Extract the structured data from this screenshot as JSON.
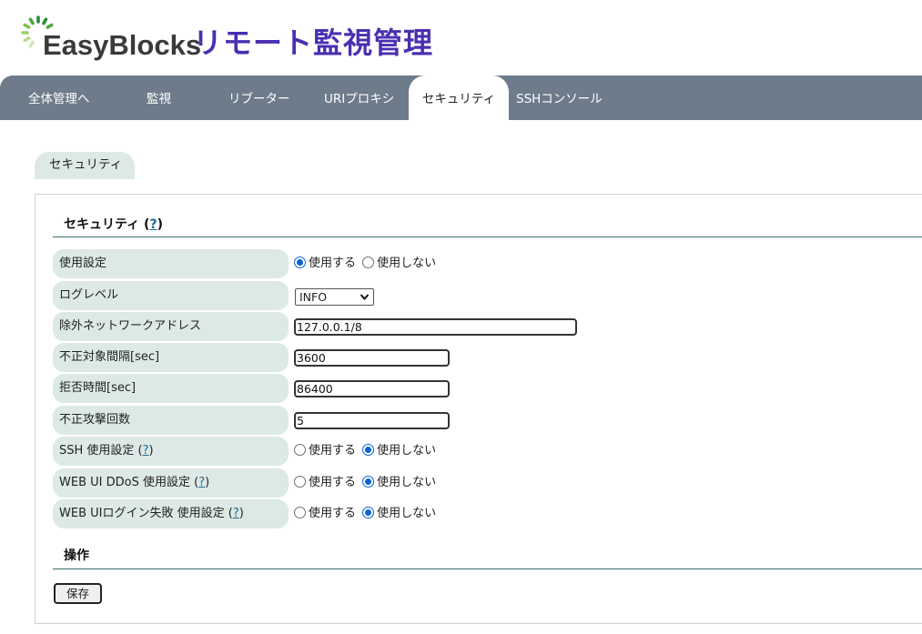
{
  "header": {
    "brand": "EasyBlocks",
    "app_title": "リモート監視管理",
    "logo_colors": [
      "#2e8b3a",
      "#7cc243",
      "#b5dc8a"
    ]
  },
  "nav": {
    "items": [
      {
        "label": "全体管理へ"
      },
      {
        "label": "監視"
      },
      {
        "label": "リブーター"
      },
      {
        "label": "URIプロキシ"
      },
      {
        "label": "セキュリティ",
        "active": true
      },
      {
        "label": "SSHコンソール"
      }
    ]
  },
  "section_tab": "セキュリティ",
  "security": {
    "heading": "セキュリティ",
    "help": "?",
    "rows": {
      "enable": {
        "label": "使用設定",
        "options": [
          "使用する",
          "使用しない"
        ],
        "selected": "使用する"
      },
      "log_level": {
        "label": "ログレベル",
        "value": "INFO"
      },
      "exclude_net": {
        "label": "除外ネットワークアドレス",
        "value": "127.0.0.1/8"
      },
      "interval": {
        "label": "不正対象間隔[sec]",
        "value": "3600"
      },
      "deny_time": {
        "label": "拒否時間[sec]",
        "value": "86400"
      },
      "attack_count": {
        "label": "不正攻撃回数",
        "value": "5"
      },
      "ssh": {
        "label": "SSH 使用設定",
        "options": [
          "使用する",
          "使用しない"
        ],
        "selected": "使用しない"
      },
      "webui_ddos": {
        "label": "WEB UI DDoS 使用設定",
        "options": [
          "使用する",
          "使用しない"
        ],
        "selected": "使用しない"
      },
      "webui_login": {
        "label": "WEB UIログイン失敗 使用設定",
        "options": [
          "使用する",
          "使用しない"
        ],
        "selected": "使用しない"
      }
    }
  },
  "operations": {
    "heading": "操作",
    "save_label": "保存"
  },
  "colors": {
    "nav_bg": "#6d7b8a",
    "title": "#4a2fb0",
    "label_bg": "#dde9e7",
    "accent": "#0b63d6"
  }
}
